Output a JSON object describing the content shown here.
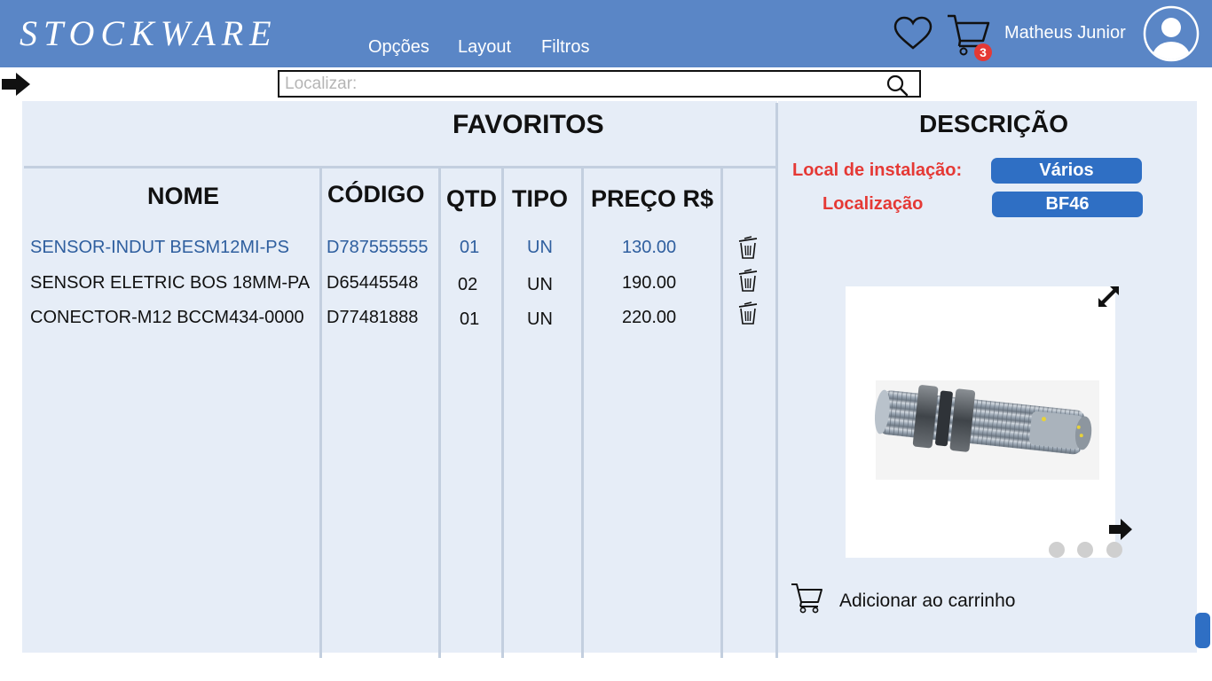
{
  "header": {
    "brand": "STOCKWARE",
    "menu": [
      "Opções",
      "Layout",
      "Filtros"
    ],
    "cart_count": "3",
    "user_name": "Matheus Junior",
    "icons": [
      "heart-icon",
      "cart-icon",
      "avatar-icon"
    ]
  },
  "search": {
    "placeholder": "Localizar:",
    "value": ""
  },
  "favorites": {
    "title": "FAVORITOS",
    "columns": [
      "NOME",
      "CÓDIGO",
      "QTD",
      "TIPO",
      "PREÇO R$"
    ],
    "rows": [
      {
        "nome": "SENSOR-INDUT BESM12MI-PS",
        "codigo": "D787555555",
        "qtd": "01",
        "tipo": "UN",
        "preco": "130.00",
        "selected": true
      },
      {
        "nome": "SENSOR ELETRIC BOS 18MM-PA",
        "codigo": "D65445548",
        "qtd": "02",
        "tipo": "UN",
        "preco": "190.00",
        "selected": false
      },
      {
        "nome": "CONECTOR-M12 BCCM434-0000",
        "codigo": "D77481888",
        "qtd": "01",
        "tipo": "UN",
        "preco": "220.00",
        "selected": false
      }
    ]
  },
  "description": {
    "title": "DESCRIÇÃO",
    "installation_label": "Local de instalação:",
    "installation_value": "Vários",
    "location_label": "Localização",
    "location_value": "BF46",
    "carousel_dots": 3,
    "add_to_cart": "Adicionar ao carrinho"
  },
  "colors": {
    "header_bg": "#5a86c6",
    "panel_bg": "#e6edf7",
    "accent_blue": "#2f6fc4",
    "label_red": "#e53935",
    "selected_text": "#2f5f9f"
  }
}
